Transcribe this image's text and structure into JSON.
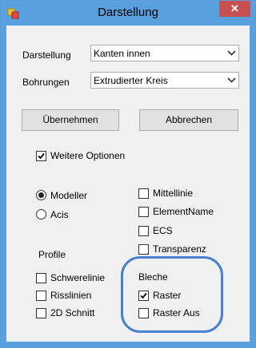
{
  "window": {
    "title": "Darstellung",
    "close_symbol": "✕"
  },
  "fields": {
    "darstellung": {
      "label": "Darstellung",
      "value": "Kanten innen"
    },
    "bohrungen": {
      "label": "Bohrungen",
      "value": "Extrudierter Kreis"
    }
  },
  "buttons": {
    "apply": "Übernehmen",
    "cancel": "Abbrechen"
  },
  "more_options": {
    "label": "Weitere Optionen",
    "checked": true
  },
  "radio": {
    "modeller": {
      "label": "Modeller",
      "selected": true
    },
    "acis": {
      "label": "Acis",
      "selected": false
    }
  },
  "right_options": [
    {
      "label": "Mittellinie",
      "checked": false
    },
    {
      "label": "ElementName",
      "checked": false
    },
    {
      "label": "ECS",
      "checked": false
    },
    {
      "label": "Transparenz",
      "checked": false
    }
  ],
  "profile": {
    "title": "Profile",
    "items": [
      {
        "label": "Schwerelinie",
        "checked": false
      },
      {
        "label": "Risslinien",
        "checked": false
      },
      {
        "label": "2D Schnitt",
        "checked": false
      }
    ]
  },
  "bleche": {
    "title": "Bleche",
    "items": [
      {
        "label": "Raster",
        "checked": true
      },
      {
        "label": "Raster Aus",
        "checked": false
      }
    ]
  },
  "colors": {
    "titlebar": "#5aa0de",
    "close": "#c75050",
    "highlight": "#4a7fd0"
  }
}
